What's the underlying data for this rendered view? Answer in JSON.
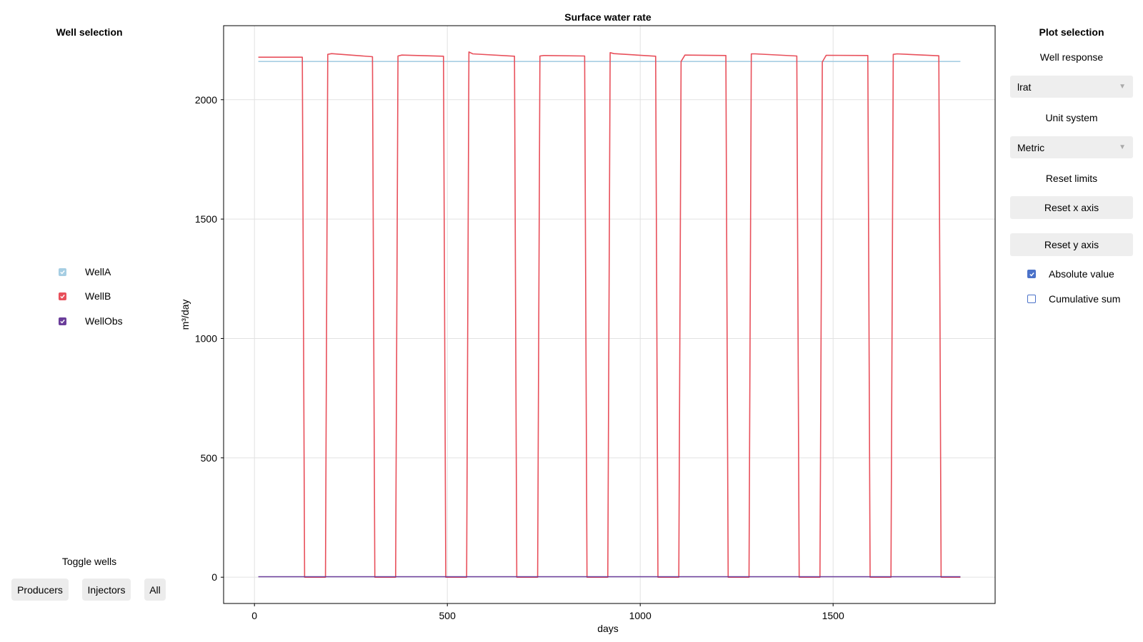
{
  "well_selection": {
    "title": "Well selection",
    "wells": [
      {
        "name": "WellA",
        "color": "#a6cee3",
        "checked": true
      },
      {
        "name": "WellB",
        "color": "#e8505b",
        "checked": true
      },
      {
        "name": "WellObs",
        "color": "#6a3d9a",
        "checked": true
      }
    ],
    "toggle_title": "Toggle wells",
    "toggle_buttons": [
      "Producers",
      "Injectors",
      "All"
    ]
  },
  "plot_selection": {
    "title": "Plot selection",
    "well_response_label": "Well response",
    "well_response_value": "lrat",
    "unit_system_label": "Unit system",
    "unit_system_value": "Metric",
    "reset_limits_label": "Reset limits",
    "reset_x_label": "Reset x axis",
    "reset_y_label": "Reset y axis",
    "absolute_value_label": "Absolute value",
    "absolute_value_checked": true,
    "cumulative_sum_label": "Cumulative sum",
    "cumulative_sum_checked": false,
    "accent_color": "#4b72c9"
  },
  "chart_data": {
    "type": "line",
    "title": "Surface water rate",
    "xlabel": "days",
    "ylabel": "m³/day",
    "xlim": [
      -80,
      1920
    ],
    "ylim": [
      -110,
      2310
    ],
    "xticks": [
      0,
      500,
      1000,
      1500
    ],
    "yticks": [
      0,
      500,
      1000,
      1500,
      2000
    ],
    "grid": true,
    "series": [
      {
        "name": "WellA",
        "color": "#a6cee3",
        "x": [
          10,
          130,
          190,
          310,
          370,
          490,
          550,
          675,
          735,
          855,
          915,
          1040,
          1100,
          1220,
          1280,
          1405,
          1465,
          1585,
          1645,
          1770,
          1830
        ],
        "y": [
          2160,
          2160,
          2160,
          2160,
          2160,
          2160,
          2160,
          2160,
          2160,
          2160,
          2160,
          2160,
          2160,
          2160,
          2160,
          2160,
          2160,
          2160,
          2160,
          2160,
          2160
        ]
      },
      {
        "name": "WellB",
        "color": "#e8505b",
        "x": [
          10,
          124,
          130,
          184,
          190,
          200,
          306,
          312,
          366,
          372,
          382,
          490,
          496,
          550,
          556,
          566,
          674,
          680,
          734,
          740,
          750,
          856,
          862,
          916,
          922,
          932,
          1040,
          1046,
          1100,
          1106,
          1116,
          1222,
          1228,
          1282,
          1288,
          1298,
          1406,
          1412,
          1466,
          1472,
          1482,
          1590,
          1596,
          1650,
          1656,
          1666,
          1774,
          1780,
          1830
        ],
        "y": [
          2178,
          2178,
          0,
          0,
          2190,
          2193,
          2180,
          0,
          0,
          2183,
          2187,
          2182,
          0,
          0,
          2200,
          2192,
          2182,
          0,
          0,
          2183,
          2185,
          2183,
          0,
          0,
          2197,
          2193,
          2182,
          0,
          0,
          2160,
          2187,
          2185,
          0,
          0,
          2192,
          2192,
          2183,
          0,
          0,
          2158,
          2186,
          2185,
          0,
          0,
          2190,
          2192,
          2184,
          0,
          0
        ]
      },
      {
        "name": "WellObs",
        "color": "#6a3d9a",
        "x": [
          10,
          1830
        ],
        "y": [
          2,
          2
        ]
      }
    ]
  }
}
